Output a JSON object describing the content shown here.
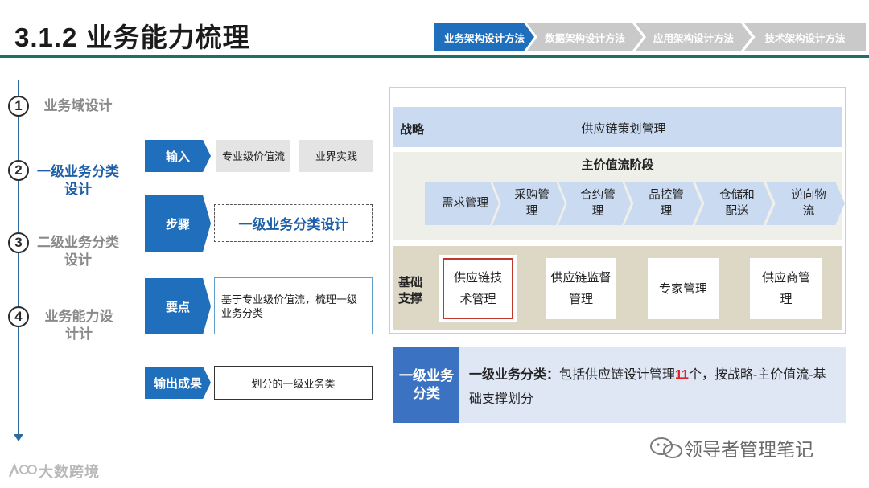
{
  "header": {
    "title": "3.1.2 业务能力梳理",
    "nav": [
      {
        "label": "业务架构设计方法",
        "active": true
      },
      {
        "label": "数据架构设计方法",
        "active": false
      },
      {
        "label": "应用架构设计方法",
        "active": false
      },
      {
        "label": "技术架构设计方法",
        "active": false
      }
    ]
  },
  "steps": [
    {
      "num": "1",
      "label": "业务域设计",
      "active": false
    },
    {
      "num": "2",
      "label": "一级业务分类设计",
      "active": true
    },
    {
      "num": "3",
      "label": "二级业务分类设计",
      "active": false
    },
    {
      "num": "4",
      "label": "业务能力设计计",
      "active": false
    }
  ],
  "process": {
    "input_label": "输入",
    "input_items": [
      "专业级价值流",
      "业界实践"
    ],
    "step_label": "步骤",
    "step_value": "一级业务分类设计",
    "key_label": "要点",
    "key_value": "基于专业级价值流，梳理一级业务分类",
    "output_label": "输出成果",
    "output_value": "划分的一级业务类"
  },
  "diagram": {
    "strategy_label": "战略",
    "strategy_value": "供应链策划管理",
    "main_title": "主价值流阶段",
    "main_stages": [
      "需求管理",
      "采购管理",
      "合约管理",
      "品控管理",
      "仓储和配送",
      "逆向物流"
    ],
    "base_label": "基础支撑",
    "base_items": [
      "供应链技术管理",
      "供应链监督管理",
      "专家管理",
      "供应商管理"
    ],
    "highlight_color": "#c0392b"
  },
  "summary": {
    "label": "一级业务分类",
    "bold_prefix": "一级业务分类：",
    "text_before": "包括供应链设计管理",
    "count": "11",
    "text_after": "个，按战略-主价值流-基础支撑划分"
  },
  "watermarks": {
    "right": "领导者管理笔记",
    "left": "大数跨境"
  },
  "colors": {
    "accent": "#1f6fbd",
    "teal_rule": "#1f6e6a",
    "count_red": "#e0202a"
  }
}
